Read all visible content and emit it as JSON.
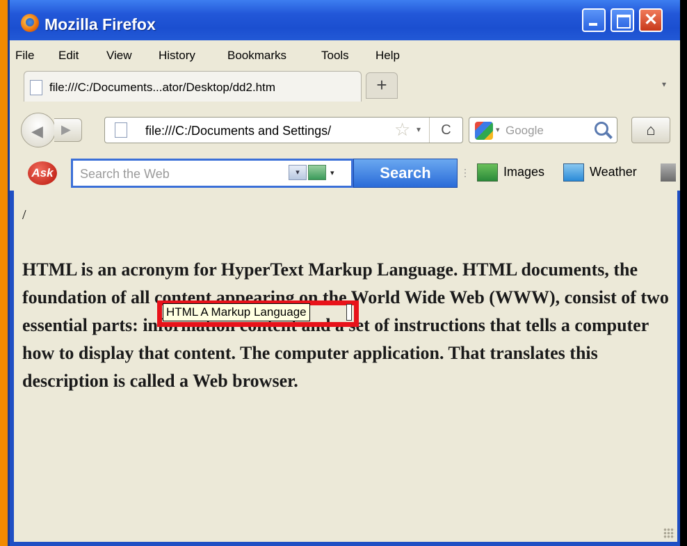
{
  "window": {
    "title": "Mozilla Firefox",
    "controls": {
      "close_glyph": "✕"
    }
  },
  "menu": [
    "File",
    "Edit",
    "View",
    "History",
    "Bookmarks",
    "Tools",
    "Help"
  ],
  "tab": {
    "title": "file:///C:/Documents...ator/Desktop/dd2.htm",
    "new_tab_glyph": "+"
  },
  "nav": {
    "url": "file:///C:/Documents and Settings/",
    "search_placeholder": "Google",
    "reload_glyph": "C"
  },
  "ask_toolbar": {
    "logo": "Ask",
    "search_placeholder": "Search the Web",
    "search_button": "Search",
    "images_label": "Images",
    "weather_label": "Weather"
  },
  "page": {
    "slash": "/",
    "paragraph": "HTML is an acronym for HyperText Markup Language. HTML documents, the foundation of all content appearing on the World Wide Web (WWW), consist of two essential parts: information content and a set of instructions that tells a computer how to display that content. The computer application. That translates this description is called a Web browser.",
    "tooltip": "HTML A Markup Language"
  },
  "colors": {
    "titlebar": "#2257d8",
    "chrome_bg": "#ece9d8",
    "highlight_frame": "#e8121a",
    "ask_button": "#2a6bd8"
  }
}
